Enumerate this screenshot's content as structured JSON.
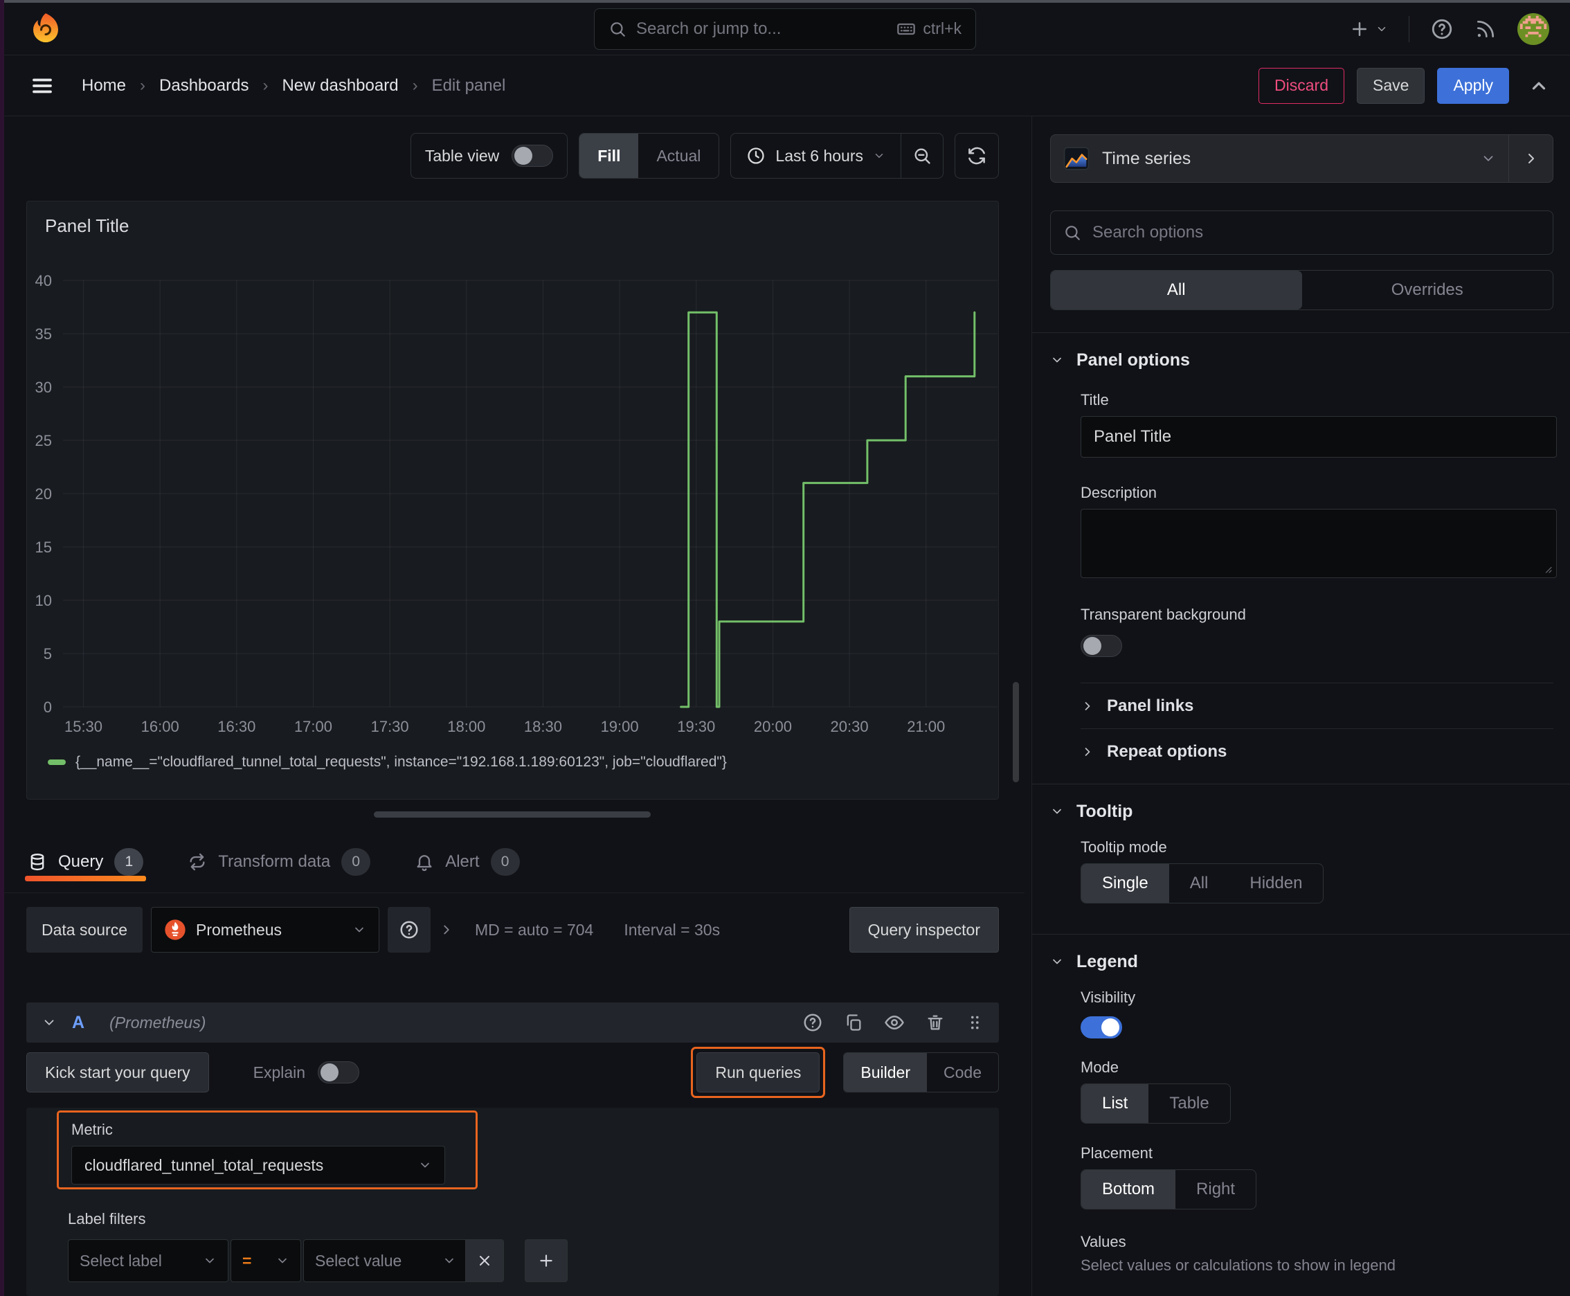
{
  "topbar": {
    "search_placeholder": "Search or jump to...",
    "shortcut": "ctrl+k"
  },
  "breadcrumb": {
    "items": [
      "Home",
      "Dashboards",
      "New dashboard",
      "Edit panel"
    ],
    "discard_label": "Discard",
    "save_label": "Save",
    "apply_label": "Apply"
  },
  "toolbar": {
    "table_view_label": "Table view",
    "fill_label": "Fill",
    "actual_label": "Actual",
    "time_range_label": "Last 6 hours"
  },
  "chart_data": {
    "type": "line",
    "line_style": "step-after",
    "title": "Panel Title",
    "color": "#73bf69",
    "grid": true,
    "legend_position": "bottom",
    "xlabel": "",
    "ylabel": "",
    "ylim": [
      0,
      40
    ],
    "y_ticks": [
      0,
      5,
      10,
      15,
      20,
      25,
      30,
      35,
      40
    ],
    "x_ticks": [
      "15:30",
      "16:00",
      "16:30",
      "17:00",
      "17:30",
      "18:00",
      "18:30",
      "19:00",
      "19:30",
      "20:00",
      "20:30",
      "21:00"
    ],
    "x_domain_minutes": [
      922,
      1288
    ],
    "series": [
      {
        "name": "{__name__=\"cloudflared_tunnel_total_requests\", instance=\"192.168.1.189:60123\", job=\"cloudflared\"}",
        "points": [
          {
            "t": "19:24",
            "v": 0
          },
          {
            "t": "19:27",
            "v": 0
          },
          {
            "t": "19:27",
            "v": 37
          },
          {
            "t": "19:38",
            "v": 37
          },
          {
            "t": "19:38",
            "v": 0
          },
          {
            "t": "19:39",
            "v": 0
          },
          {
            "t": "19:39",
            "v": 8
          },
          {
            "t": "20:12",
            "v": 8
          },
          {
            "t": "20:12",
            "v": 21
          },
          {
            "t": "20:37",
            "v": 21
          },
          {
            "t": "20:37",
            "v": 25
          },
          {
            "t": "20:52",
            "v": 25
          },
          {
            "t": "20:52",
            "v": 31
          },
          {
            "t": "21:19",
            "v": 31
          },
          {
            "t": "21:19",
            "v": 37
          }
        ]
      }
    ]
  },
  "tabs": {
    "query_label": "Query",
    "query_count": "1",
    "transform_label": "Transform data",
    "transform_count": "0",
    "alert_label": "Alert",
    "alert_count": "0"
  },
  "datasource_row": {
    "label": "Data source",
    "value": "Prometheus",
    "stats_md": "MD = auto = 704",
    "stats_interval": "Interval = 30s",
    "inspector_label": "Query inspector"
  },
  "query_editor": {
    "ref_id": "A",
    "ds_hint": "(Prometheus)",
    "kick_start_label": "Kick start your query",
    "explain_label": "Explain",
    "run_queries_label": "Run queries",
    "builder_label": "Builder",
    "code_label": "Code",
    "metric_label": "Metric",
    "metric_value": "cloudflared_tunnel_total_requests",
    "label_filters_label": "Label filters",
    "select_label_placeholder": "Select label",
    "operator": "=",
    "select_value_placeholder": "Select value"
  },
  "options_pane": {
    "viz_type": "Time series",
    "search_placeholder": "Search options",
    "tab_all": "All",
    "tab_overrides": "Overrides",
    "panel_options": {
      "title": "Panel options",
      "title_label": "Title",
      "title_value": "Panel Title",
      "description_label": "Description",
      "transparent_label": "Transparent background"
    },
    "links_label": "Panel links",
    "repeat_label": "Repeat options",
    "tooltip": {
      "title": "Tooltip",
      "mode_label": "Tooltip mode",
      "options": [
        "Single",
        "All",
        "Hidden"
      ]
    },
    "legend": {
      "title": "Legend",
      "visibility_label": "Visibility",
      "mode_label": "Mode",
      "mode_options": [
        "List",
        "Table"
      ],
      "placement_label": "Placement",
      "placement_options": [
        "Bottom",
        "Right"
      ],
      "values_label": "Values",
      "values_help": "Select values or calculations to show in legend"
    }
  },
  "colors": {
    "accent_blue": "#3d71d9",
    "series_green": "#73bf69",
    "highlight_orange": "#e8641f",
    "destructive_pink": "#e02c64"
  }
}
